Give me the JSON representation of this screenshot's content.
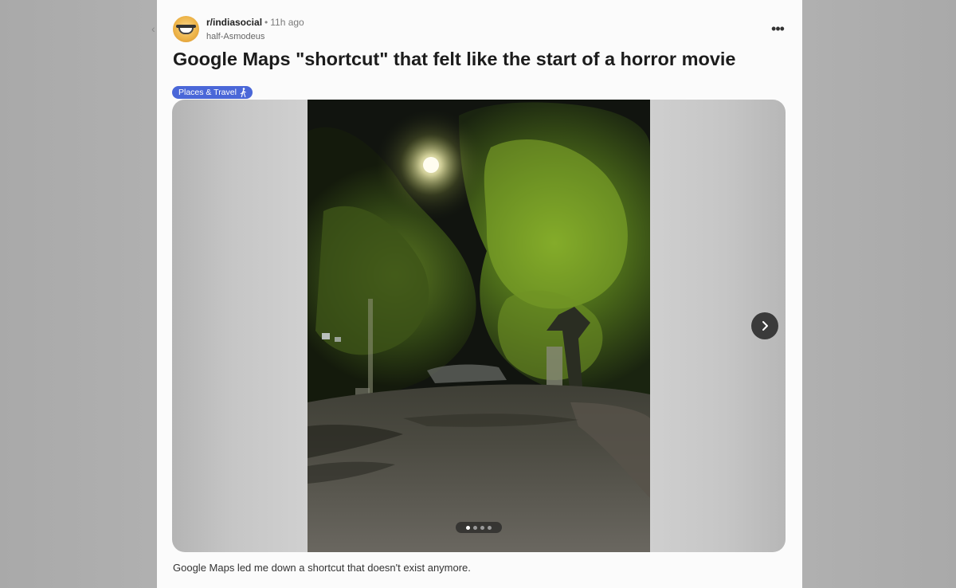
{
  "post": {
    "subreddit": "r/indiasocial",
    "separator": "•",
    "time_ago": "11h ago",
    "author": "half-Asmodeus",
    "more_options_label": "•••",
    "title": "Google Maps \"shortcut\" that felt like the start of a horror movie",
    "flair": {
      "label": "Places & Travel",
      "icon": "walking-person-icon",
      "color": "#4a67d8"
    },
    "media": {
      "image_description_icon": "night-street-photo",
      "gallery_total": 4,
      "gallery_current": 1,
      "next_icon": "chevron-right-icon"
    },
    "caption": "Google Maps led me down a shortcut that doesn't exist anymore."
  },
  "colors": {
    "page_background": "#b0b0b0",
    "card_background": "#fbfbfb",
    "title_text": "#1c1c1c",
    "flair_background": "#4a67d8"
  }
}
